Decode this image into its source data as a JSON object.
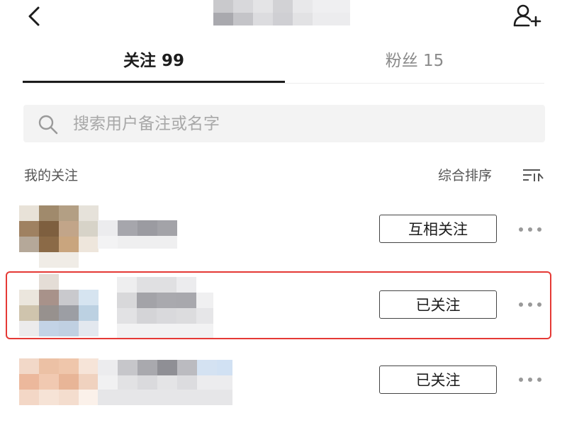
{
  "header": {
    "back_icon": "chevron-left-icon",
    "add_user_icon": "add-user-icon"
  },
  "tabs": [
    {
      "label": "关注 99",
      "active": true
    },
    {
      "label": "粉丝 15",
      "active": false
    }
  ],
  "search": {
    "placeholder": "搜索用户备注或名字",
    "value": "",
    "icon": "search-icon"
  },
  "section": {
    "title": "我的关注",
    "sort_label": "综合排序",
    "sort_icon": "sort-icon"
  },
  "users": [
    {
      "button_label": "互相关注",
      "highlighted": false
    },
    {
      "button_label": "已关注",
      "highlighted": true
    },
    {
      "button_label": "已关注",
      "highlighted": false
    }
  ],
  "colors": {
    "highlight": "#e53935",
    "active_tab": "#1c1c1c",
    "inactive_tab": "#8a8a8a",
    "search_bg": "#f3f3f3"
  }
}
